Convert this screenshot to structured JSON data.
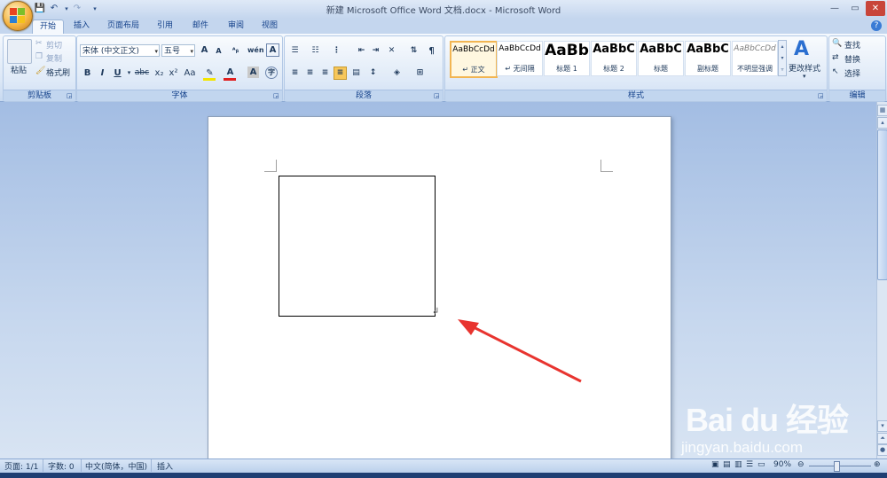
{
  "window": {
    "title": "新建 Microsoft Office Word 文档.docx - Microsoft Word"
  },
  "tabs": [
    "开始",
    "插入",
    "页面布局",
    "引用",
    "邮件",
    "审阅",
    "视图"
  ],
  "clipboard": {
    "paste": "粘贴",
    "cut": "剪切",
    "copy": "复制",
    "format_painter": "格式刷",
    "label": "剪贴板"
  },
  "font": {
    "name": "宋体 (中文正文)",
    "size": "五号",
    "label": "字体",
    "bold": "B",
    "italic": "I",
    "underline": "U",
    "strike": "abc",
    "subscript": "x₂",
    "superscript": "x²",
    "change_case": "Aa",
    "grow": "A",
    "shrink": "A",
    "font_color": "A",
    "char_shade": "A",
    "highlight_color": "#f3e400",
    "font_color_value": "#e02020"
  },
  "paragraph": {
    "label": "段落"
  },
  "styles": {
    "label": "样式",
    "items": [
      {
        "preview": "AaBbCcDd",
        "name": "↵ 正文"
      },
      {
        "preview": "AaBbCcDd",
        "name": "↵ 无间隔"
      },
      {
        "preview": "AaBb",
        "name": "标题 1"
      },
      {
        "preview": "AaBbC",
        "name": "标题 2"
      },
      {
        "preview": "AaBbC",
        "name": "标题"
      },
      {
        "preview": "AaBbC",
        "name": "副标题"
      },
      {
        "preview": "AaBbCcDd",
        "name": "不明显强调"
      }
    ],
    "change_styles": "更改样式"
  },
  "editing": {
    "label": "编辑",
    "find": "查找",
    "replace": "替换",
    "select": "选择"
  },
  "status": {
    "page": "页面: 1/1",
    "words": "字数: 0",
    "language": "中文(简体，中国)",
    "mode": "插入",
    "zoom": "90%"
  },
  "watermark": {
    "brand": "Bai du 经验",
    "url": "jingyan.baidu.com"
  },
  "annotation_color": "#e8342f"
}
